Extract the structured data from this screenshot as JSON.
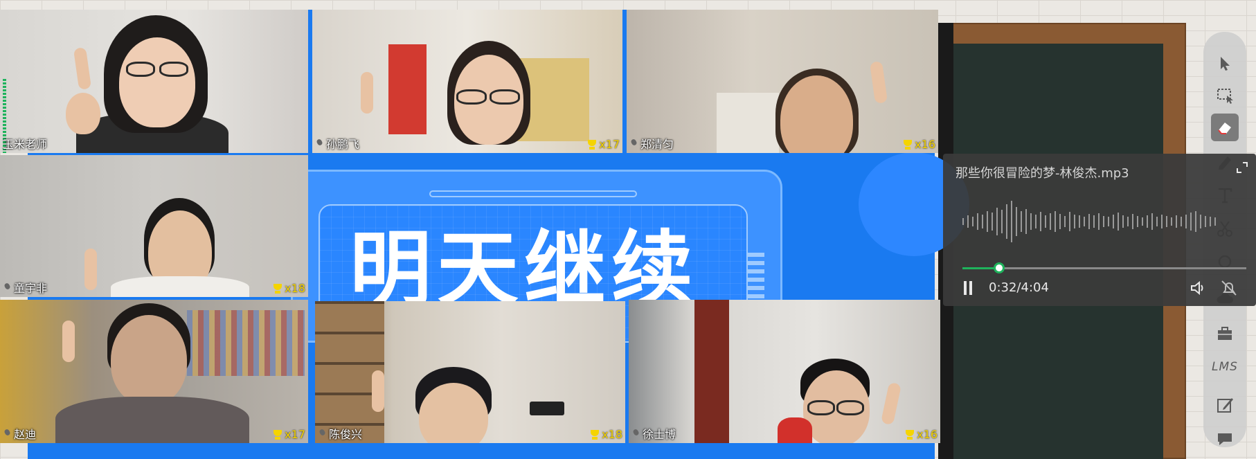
{
  "slide": {
    "title": "明天继续"
  },
  "participants": [
    {
      "name": "玉米老师",
      "trophies": "",
      "is_teacher": true
    },
    {
      "name": "孙鹏飞",
      "trophies": "x17"
    },
    {
      "name": "郑清匀",
      "trophies": "x16"
    },
    {
      "name": "童宇非",
      "trophies": "x18"
    },
    {
      "name": "赵迪",
      "trophies": "x17"
    },
    {
      "name": "陈俊兴",
      "trophies": "x18"
    },
    {
      "name": "徐士博",
      "trophies": "x16"
    }
  ],
  "player": {
    "track_title": "那些你很冒险的梦-林俊杰.mp3",
    "current_time": "0:32",
    "total_time": "/4:04",
    "progress": 0.13,
    "state": "playing"
  },
  "toolbar": {
    "items": [
      "pointer-icon",
      "select-icon",
      "eraser-icon",
      "pen-icon",
      "text-icon",
      "scissors-icon",
      "shape-icon",
      "cloud-icon",
      "toolbox-icon",
      "lms-icon",
      "edit-icon",
      "chat-icon"
    ],
    "lms_label": "LMS",
    "active": "eraser-icon"
  },
  "colors": {
    "slide_blue": "#1a7af0",
    "progress_green": "#1fb35c",
    "trophy_yellow": "#f5d400",
    "chalkboard": "#26332f"
  }
}
